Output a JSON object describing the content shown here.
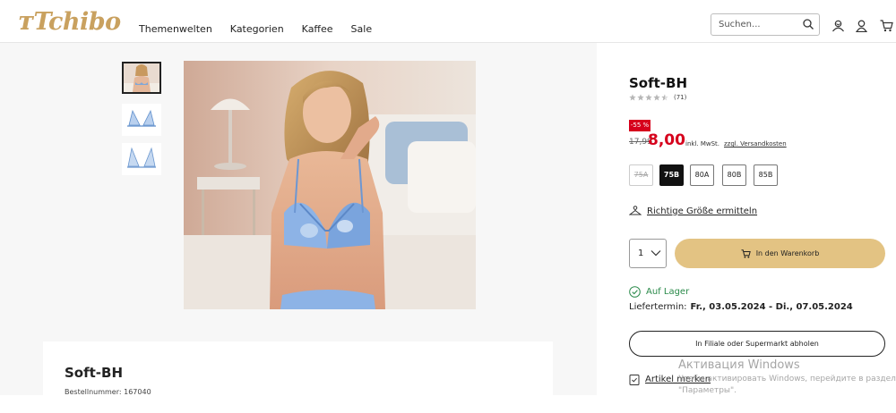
{
  "header": {
    "logo": "Tchibo",
    "nav": [
      "Themenwelten",
      "Kategorien",
      "Kaffee",
      "Sale"
    ],
    "search_placeholder": "Suchen...",
    "icons": [
      "search-icon",
      "member-icon",
      "account-icon",
      "cart-icon"
    ]
  },
  "product": {
    "title": "Soft-BH",
    "rating_count": "(71)",
    "rating": 4.5,
    "discount_badge": "-55 %",
    "old_price": "17,99",
    "new_price": "8,00",
    "vat_text": "inkl. MwSt.",
    "shipping_link": "zzgl. Versandkosten",
    "sizes": [
      {
        "label": "75A",
        "state": "disabled"
      },
      {
        "label": "75B",
        "state": "selected"
      },
      {
        "label": "80A",
        "state": "available"
      },
      {
        "label": "80B",
        "state": "available"
      },
      {
        "label": "85B",
        "state": "available"
      }
    ],
    "size_help": "Richtige Größe ermitteln",
    "quantity": "1",
    "add_to_cart": "In den Warenkorb",
    "stock": "Auf Lager",
    "delivery_label": "Liefertermin:",
    "delivery_dates": "Fr., 03.05.2024 - Di., 07.05.2024",
    "pickup": "In Filiale oder Supermarkt abholen",
    "wishlist": "Artikel merken"
  },
  "info_card": {
    "title": "Soft-BH",
    "article_number": "Bestellnummer: 167040"
  },
  "watermark": {
    "line1": "Активация Windows",
    "line2": "Чтобы активировать Windows, перейдите в раздел",
    "line3": "\"Параметры\"."
  },
  "colors": {
    "accent": "#c9a15f",
    "cart_button": "#e3c383",
    "sale_red": "#d6001c",
    "stock_green": "#2a8a4a"
  }
}
